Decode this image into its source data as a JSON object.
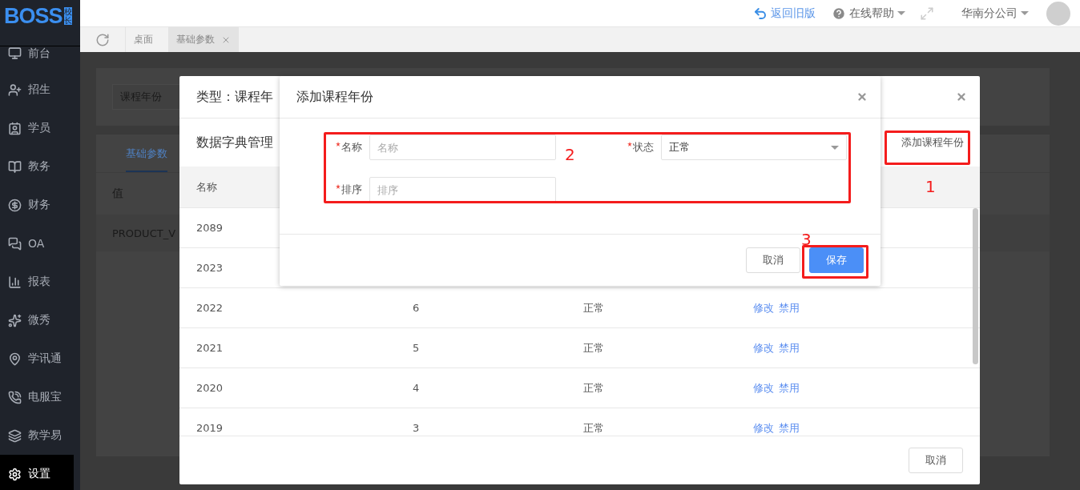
{
  "logo": {
    "text": "BOSS",
    "badge": "校长"
  },
  "sidebar": {
    "items": [
      {
        "label": "前台",
        "selected": false
      },
      {
        "label": "招生",
        "selected": false
      },
      {
        "label": "学员",
        "selected": false
      },
      {
        "label": "教务",
        "selected": false
      },
      {
        "label": "财务",
        "selected": false
      },
      {
        "label": "OA",
        "selected": false
      },
      {
        "label": "报表",
        "selected": false
      },
      {
        "label": "微秀",
        "selected": false
      },
      {
        "label": "学讯通",
        "selected": false
      },
      {
        "label": "电服宝",
        "selected": false
      },
      {
        "label": "教学易",
        "selected": false
      },
      {
        "label": "设置",
        "selected": true
      }
    ]
  },
  "header": {
    "back_link": "返回旧版",
    "help": "在线帮助",
    "branch": "华南分公司"
  },
  "tabs": [
    {
      "label": "桌面",
      "selected": false,
      "closable": false
    },
    {
      "label": "基础参数",
      "selected": true,
      "closable": true
    }
  ],
  "page": {
    "filter_select": "课程年份",
    "tabs": [
      {
        "label": "基础参数",
        "selected": true
      }
    ],
    "columns": [
      "值"
    ],
    "rows": [
      "PRODUCT_V"
    ]
  },
  "dictionary_dialog": {
    "title": "类型：课程年",
    "section_title": "数据字典管理",
    "add_button": "添加课程年份",
    "columns": [
      "名称"
    ],
    "rows": [
      {
        "name": "2089"
      },
      {
        "name": "2023"
      },
      {
        "name": "2022",
        "sort": "6",
        "status": "正常",
        "actions": [
          "修改",
          "禁用"
        ]
      },
      {
        "name": "2021",
        "sort": "5",
        "status": "正常",
        "actions": [
          "修改",
          "禁用"
        ]
      },
      {
        "name": "2020",
        "sort": "4",
        "status": "正常",
        "actions": [
          "修改",
          "禁用"
        ]
      },
      {
        "name": "2019",
        "sort": "3",
        "status": "正常",
        "actions": [
          "修改",
          "禁用"
        ]
      }
    ],
    "cancel_button": "取消"
  },
  "add_dialog": {
    "title": "添加课程年份",
    "fields": [
      {
        "kind": "input",
        "label": "名称",
        "required": true,
        "placeholder": "名称"
      },
      {
        "kind": "select",
        "label": "状态",
        "required": true,
        "value": "正常"
      },
      {
        "kind": "input",
        "label": "排序",
        "required": true,
        "placeholder": "排序"
      }
    ],
    "buttons": [
      {
        "label": "取消",
        "kind": "default"
      },
      {
        "label": "保存",
        "kind": "primary"
      }
    ]
  },
  "annotations": [
    {
      "number": "1"
    },
    {
      "number": "2"
    },
    {
      "number": "3"
    }
  ]
}
